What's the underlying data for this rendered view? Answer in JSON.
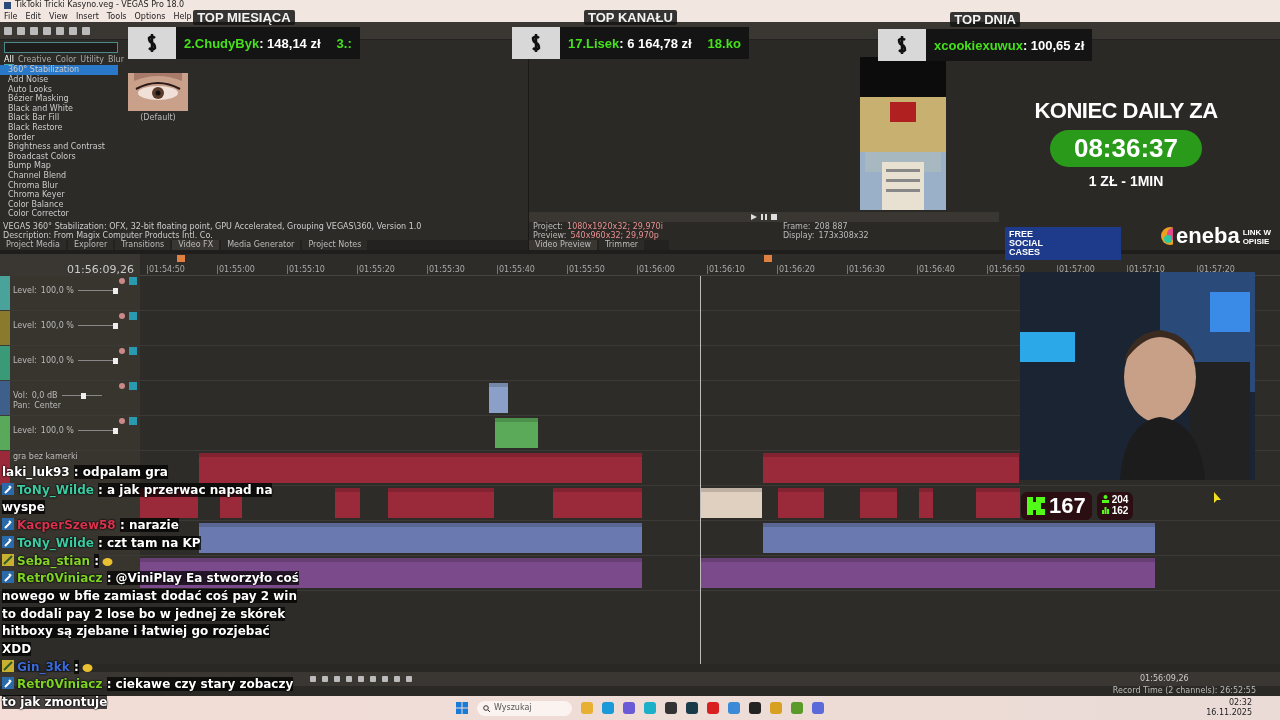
{
  "window": {
    "title": "TikToki Tricki Kasyno.veg - VEGAS Pro 18.0"
  },
  "menu": [
    "File",
    "Edit",
    "View",
    "Insert",
    "Tools",
    "Options",
    "Help"
  ],
  "fx_panel": {
    "tabs": [
      {
        "label": "All",
        "selected": true
      },
      {
        "label": "Creative",
        "selected": false
      },
      {
        "label": "Color",
        "selected": false
      },
      {
        "label": "Utility",
        "selected": false
      },
      {
        "label": "Blur",
        "selected": false
      }
    ],
    "items": [
      {
        "label": "360° Stabilization",
        "selected": true
      },
      {
        "label": "Add Noise",
        "selected": false
      },
      {
        "label": "Auto Looks",
        "selected": false
      },
      {
        "label": "Bézier Masking",
        "selected": false
      },
      {
        "label": "Black and White",
        "selected": false
      },
      {
        "label": "Black Bar Fill",
        "selected": false
      },
      {
        "label": "Black Restore",
        "selected": false
      },
      {
        "label": "Border",
        "selected": false
      },
      {
        "label": "Brightness and Contrast",
        "selected": false
      },
      {
        "label": "Broadcast Colors",
        "selected": false
      },
      {
        "label": "Bump Map",
        "selected": false
      },
      {
        "label": "Channel Blend",
        "selected": false
      },
      {
        "label": "Chroma Blur",
        "selected": false
      },
      {
        "label": "Chroma Keyer",
        "selected": false
      },
      {
        "label": "Color Balance",
        "selected": false
      },
      {
        "label": "Color Corrector",
        "selected": false
      }
    ],
    "preset_caption": "(Default)",
    "info": [
      "VEGAS 360° Stabilization: OFX, 32-bit floating point, GPU Accelerated, Grouping VEGAS\\360, Version 1.0",
      "Description: From Magix Computer Products Intl. Co."
    ]
  },
  "dock_tabs": [
    {
      "label": "Project Media",
      "selected": false
    },
    {
      "label": "Explorer",
      "selected": false
    },
    {
      "label": "Transitions",
      "selected": false
    },
    {
      "label": "Video FX",
      "selected": true
    },
    {
      "label": "Media Generator",
      "selected": false
    },
    {
      "label": "Project Notes",
      "selected": false
    }
  ],
  "preview": {
    "info_left": [
      {
        "label": "Project:",
        "value": "1080x1920x32; 29,970i"
      },
      {
        "label": "Preview:",
        "value": "540x960x32; 29,970p"
      }
    ],
    "info_right": [
      {
        "label": "Frame:",
        "value": "208 887"
      },
      {
        "label": "Display:",
        "value": "173x308x32"
      }
    ],
    "tabs": [
      {
        "label": "Video Preview",
        "selected": true
      },
      {
        "label": "Trimmer",
        "selected": false
      }
    ]
  },
  "timeline": {
    "timecode": "01:56:09,26",
    "ruler": [
      "01:54:50",
      "01:55:00",
      "01:55:10",
      "01:55:20",
      "01:55:30",
      "01:55:40",
      "01:55:50",
      "01:56:00",
      "01:56:10",
      "01:56:20",
      "01:56:30",
      "01:56:40",
      "01:56:50",
      "01:57:00",
      "01:57:10",
      "01:57:20"
    ],
    "tracks": [
      {
        "kind": "video",
        "color": "#4aa39a",
        "label": "Level:",
        "value": "100,0 %",
        "level": 1
      },
      {
        "kind": "video",
        "color": "#8a7a2e",
        "label": "Level:",
        "value": "100,0 %",
        "level": 1
      },
      {
        "kind": "video",
        "color": "#3a9a78",
        "label": "Level:",
        "value": "100,0 %",
        "level": 1
      },
      {
        "kind": "audio",
        "color": "#3e5f8a",
        "label": "Vol:",
        "value": "0,0 dB",
        "level": 0.55,
        "pan_label": "Pan:",
        "pan": "Center"
      },
      {
        "kind": "video",
        "color": "#5aa85a",
        "label": "Level:",
        "value": "100,0 %",
        "level": 1
      },
      {
        "kind": "named",
        "color": "#9a2a3a",
        "name": "gra bez kamerki"
      },
      {
        "kind": "plain"
      },
      {
        "kind": "plain"
      },
      {
        "kind": "plain"
      }
    ],
    "status_time": "01:56:09,26",
    "record_time": "Record Time (2 channels): 26:52:55"
  },
  "leaderboards": [
    {
      "title": "TOP MIESIĄCA",
      "entries": [
        {
          "name": "2.ChudyByk",
          "amount": ": 148,14 zł"
        },
        {
          "name": "3.:"
        }
      ]
    },
    {
      "title": "TOP KANAŁU",
      "entries": [
        {
          "name": "17.Lisek",
          "amount": ": 6 164,78 zł"
        },
        {
          "name": "18.ko"
        }
      ]
    },
    {
      "title": "TOP DNIA",
      "entries": [
        {
          "name": "xcookiexuwux",
          "amount": ": 100,65 zł"
        }
      ]
    }
  ],
  "countdown": {
    "title": "KONIEC DAILY ZA",
    "time": "08:36:37",
    "rate": "1 ZŁ - 1MIN"
  },
  "promos": {
    "cases": [
      "FREE",
      "SOCIAL",
      "CASES"
    ],
    "brand": "eneba",
    "brand_note": "LINK W OPISIE"
  },
  "viewers": {
    "count": "167",
    "followers": "204",
    "subs": "162"
  },
  "chat": [
    {
      "kind": "plain",
      "user": "laki_luk93",
      "color": "#ffffff",
      "text": ": odpalam gra"
    },
    {
      "kind": "wrench",
      "user": "ToNy_Wilde",
      "color": "#3ccaa0",
      "text": ": a jak przerwac napad na wyspe"
    },
    {
      "kind": "wrench",
      "user": "KacperSzew58",
      "color": "#d8344e",
      "text": ": narazie"
    },
    {
      "kind": "wrench",
      "user": "ToNy_Wilde",
      "color": "#3ccaa0",
      "text": ": czt tam na KP"
    },
    {
      "kind": "gift",
      "user": "Seba_stian",
      "color": "#86d42a",
      "text": ":",
      "emote": true
    },
    {
      "kind": "wrench",
      "user": "Retr0Viniacz",
      "color": "#7ed321",
      "text": ": @ViniPlay Ea stworzyło coś nowego w bfie zamiast dodać coś pay 2 win to dodali pay 2 lose bo w jednej że skórek hitboxy są zjebane i łatwiej go rozjebać XDD"
    },
    {
      "kind": "gift",
      "user": "Gin_3kk",
      "color": "#3a6ad8",
      "text": ":",
      "emote": true
    },
    {
      "kind": "wrench",
      "user": "Retr0Viniacz",
      "color": "#7ed321",
      "text": ": ciekawe czy stary zobaczy to jak zmontuje"
    }
  ],
  "taskbar": {
    "search": "Wyszukaj",
    "time": "02:32",
    "date": "16.11.2025"
  }
}
